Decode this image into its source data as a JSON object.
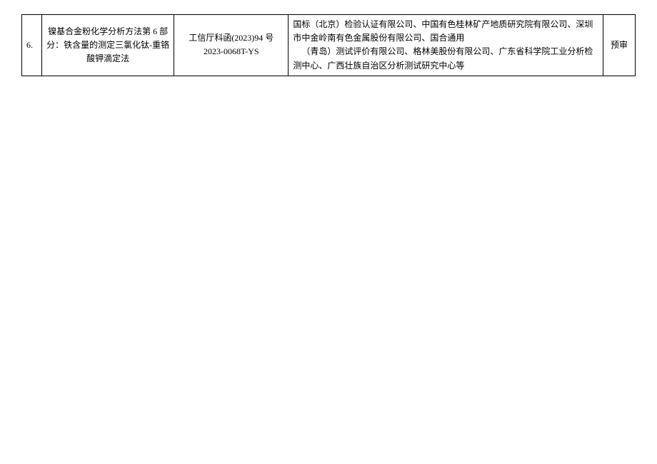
{
  "table": {
    "rows": [
      {
        "index": "6.",
        "title": "镍基合金粉化学分析方法第 6 部分：铁含量的测定三氯化钛-重铬酸钾滴定法",
        "reference": "工信厅科函(2023)94 号 2023-0068T-YS",
        "organizations_line1": "国标（北京）检验认证有限公司、中国有色桂林矿产地质研究院有限公司、深圳市中金岭南有色金属股份有限公司、国合通用",
        "organizations_line2": "（青岛）测试评价有限公司、格林美股份有限公司、广东省科学院工业分析检测中心、广西壮族自治区分析测试研究中心等",
        "status": "预审"
      }
    ]
  }
}
